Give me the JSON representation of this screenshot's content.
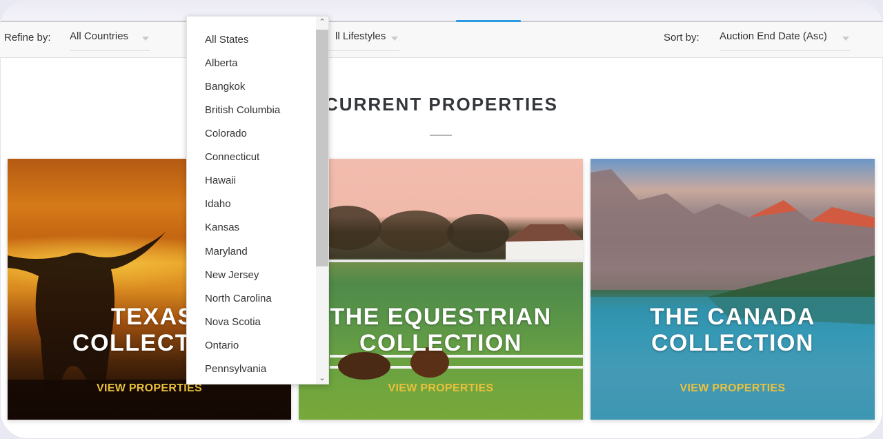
{
  "filters": {
    "refine_label": "Refine by:",
    "country_select": {
      "value": "All Countries"
    },
    "lifestyle_select": {
      "value": "ll Lifestyles"
    },
    "sort_label": "Sort by:",
    "sort_select": {
      "value": "Auction End Date (Asc)"
    }
  },
  "state_dropdown": {
    "options": [
      "All States",
      "Alberta",
      "Bangkok",
      "British Columbia",
      "Colorado",
      "Connecticut",
      "Hawaii",
      "Idaho",
      "Kansas",
      "Maryland",
      "New Jersey",
      "North Carolina",
      "Nova Scotia",
      "Ontario",
      "Pennsylvania"
    ],
    "scroll_up_icon": "chevron-up-icon",
    "scroll_down_icon": "chevron-down-icon"
  },
  "section": {
    "title": "CURRENT PROPERTIES"
  },
  "collections": [
    {
      "line1": "TEXAS",
      "line2": "COLLECTION",
      "cta": "VIEW PROPERTIES"
    },
    {
      "line1": "THE EQUESTRIAN",
      "line2": "COLLECTION",
      "cta": "VIEW PROPERTIES"
    },
    {
      "line1": "THE CANADA",
      "line2": "COLLECTION",
      "cta": "VIEW PROPERTIES"
    }
  ],
  "colors": {
    "accent": "#2a9be0",
    "cta": "#e9c13c"
  }
}
